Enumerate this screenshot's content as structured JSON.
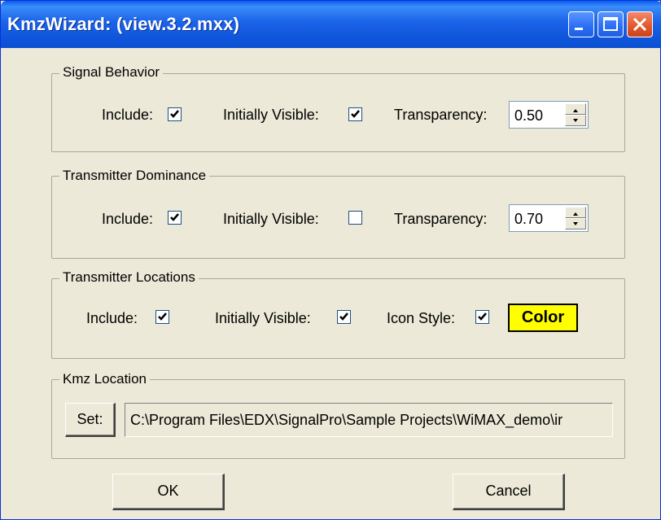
{
  "window": {
    "title": "KmzWizard: (view.3.2.mxx)"
  },
  "signal_behavior": {
    "title": "Signal Behavior",
    "include_label": "Include:",
    "include_checked": true,
    "visible_label": "Initially Visible:",
    "visible_checked": true,
    "transparency_label": "Transparency:",
    "transparency_value": "0.50"
  },
  "transmitter_dominance": {
    "title": "Transmitter Dominance",
    "include_label": "Include:",
    "include_checked": true,
    "visible_label": "Initially Visible:",
    "visible_checked": false,
    "transparency_label": "Transparency:",
    "transparency_value": "0.70"
  },
  "transmitter_locations": {
    "title": "Transmitter Locations",
    "include_label": "Include:",
    "include_checked": true,
    "visible_label": "Initially Visible:",
    "visible_checked": true,
    "icon_style_label": "Icon Style:",
    "icon_style_checked": true,
    "color_label": "Color",
    "color_value": "#ffff00"
  },
  "kmz_location": {
    "title": "Kmz Location",
    "set_label": "Set:",
    "path": "C:\\Program Files\\EDX\\SignalPro\\Sample Projects\\WiMAX_demo\\ir"
  },
  "buttons": {
    "ok": "OK",
    "cancel": "Cancel"
  }
}
